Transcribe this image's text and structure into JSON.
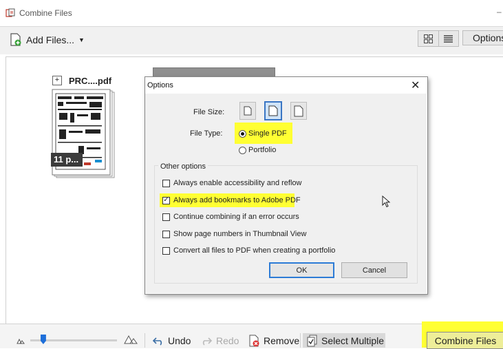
{
  "window": {
    "title": "Combine Files",
    "minimize_glyph": "–"
  },
  "toolbar": {
    "add_files_label": "Add Files...",
    "options_label": "Options"
  },
  "file": {
    "name": "PRC....pdf",
    "page_count_label": "11 p...",
    "expand_glyph": "+"
  },
  "dialog": {
    "title": "Options",
    "close_glyph": "✕",
    "file_size_label": "File Size:",
    "file_type_label": "File Type:",
    "file_type_options": [
      "Single PDF",
      "Portfolio"
    ],
    "file_type_selected": "Single PDF",
    "other_options_label": "Other options",
    "checkboxes": [
      {
        "label": "Always enable accessibility and reflow",
        "checked": false
      },
      {
        "label": "Always add bookmarks to Adobe PDF",
        "checked": true
      },
      {
        "label": "Continue combining if an error occurs",
        "checked": false
      },
      {
        "label": "Show page numbers in Thumbnail View",
        "checked": false
      },
      {
        "label": "Convert all files to PDF when creating a portfolio",
        "checked": false
      }
    ],
    "ok_label": "OK",
    "cancel_label": "Cancel"
  },
  "bottombar": {
    "undo_label": "Undo",
    "redo_label": "Redo",
    "remove_label": "Remove",
    "select_multiple_label": "Select Multiple",
    "combine_label": "Combine Files",
    "zoom_level": 0.15
  },
  "colors": {
    "highlight": "#ffff33",
    "accent": "#2c7bd6"
  }
}
